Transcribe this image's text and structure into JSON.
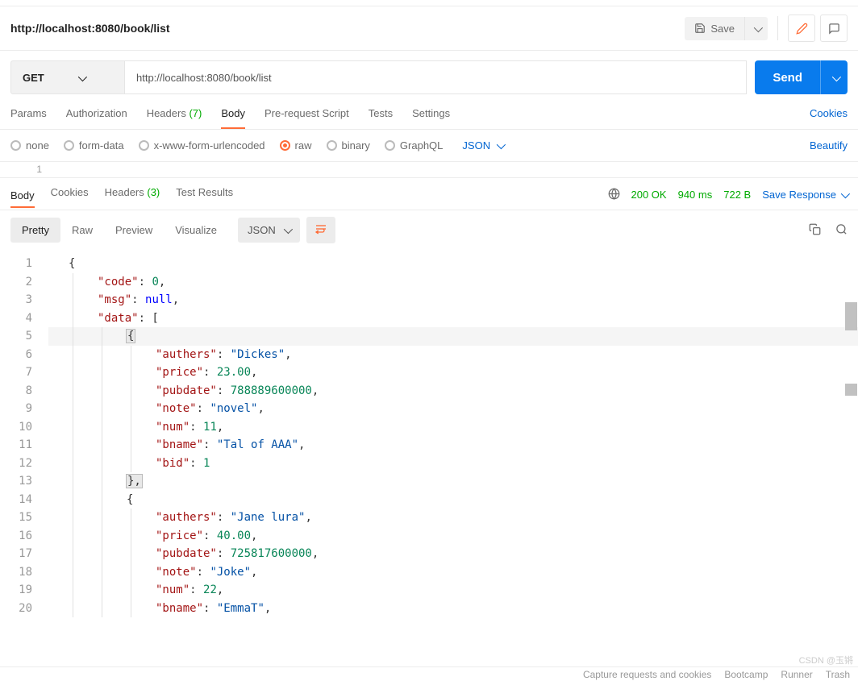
{
  "title": "http://localhost:8080/book/list",
  "save_label": "Save",
  "request": {
    "method": "GET",
    "url": "http://localhost:8080/book/list",
    "send_label": "Send"
  },
  "req_tabs": {
    "params": "Params",
    "auth": "Authorization",
    "headers": "Headers",
    "headers_count": "(7)",
    "body": "Body",
    "prs": "Pre-request Script",
    "tests": "Tests",
    "settings": "Settings",
    "cookies": "Cookies"
  },
  "body_types": {
    "none": "none",
    "formdata": "form-data",
    "urlenc": "x-www-form-urlencoded",
    "raw": "raw",
    "binary": "binary",
    "graphql": "GraphQL",
    "json": "JSON",
    "beautify": "Beautify"
  },
  "editor_line": "1",
  "resp_tabs": {
    "body": "Body",
    "cookies": "Cookies",
    "headers": "Headers",
    "headers_count": "(3)",
    "tests": "Test Results"
  },
  "resp_meta": {
    "status": "200 OK",
    "time": "940 ms",
    "size": "722 B",
    "save": "Save Response"
  },
  "view_tabs": {
    "pretty": "Pretty",
    "raw": "Raw",
    "preview": "Preview",
    "visualize": "Visualize",
    "json": "JSON"
  },
  "lines": [
    {
      "n": "1",
      "t": [
        {
          "c": "p",
          "v": "{"
        }
      ]
    },
    {
      "n": "2",
      "i": 1,
      "t": [
        {
          "c": "k",
          "v": "\"code\""
        },
        {
          "c": "p",
          "v": ": "
        },
        {
          "c": "n",
          "v": "0"
        },
        {
          "c": "p",
          "v": ","
        }
      ]
    },
    {
      "n": "3",
      "i": 1,
      "t": [
        {
          "c": "k",
          "v": "\"msg\""
        },
        {
          "c": "p",
          "v": ": "
        },
        {
          "c": "nul",
          "v": "null"
        },
        {
          "c": "p",
          "v": ","
        }
      ]
    },
    {
      "n": "4",
      "i": 1,
      "t": [
        {
          "c": "k",
          "v": "\"data\""
        },
        {
          "c": "p",
          "v": ": ["
        }
      ]
    },
    {
      "n": "5",
      "i": 2,
      "hl": true,
      "t": [
        {
          "c": "p",
          "v": "{"
        }
      ],
      "box": true
    },
    {
      "n": "6",
      "i": 3,
      "t": [
        {
          "c": "k",
          "v": "\"authers\""
        },
        {
          "c": "p",
          "v": ": "
        },
        {
          "c": "s",
          "v": "\"Dickes\""
        },
        {
          "c": "p",
          "v": ","
        }
      ]
    },
    {
      "n": "7",
      "i": 3,
      "t": [
        {
          "c": "k",
          "v": "\"price\""
        },
        {
          "c": "p",
          "v": ": "
        },
        {
          "c": "n",
          "v": "23.00"
        },
        {
          "c": "p",
          "v": ","
        }
      ]
    },
    {
      "n": "8",
      "i": 3,
      "t": [
        {
          "c": "k",
          "v": "\"pubdate\""
        },
        {
          "c": "p",
          "v": ": "
        },
        {
          "c": "n",
          "v": "788889600000"
        },
        {
          "c": "p",
          "v": ","
        }
      ]
    },
    {
      "n": "9",
      "i": 3,
      "t": [
        {
          "c": "k",
          "v": "\"note\""
        },
        {
          "c": "p",
          "v": ": "
        },
        {
          "c": "s",
          "v": "\"novel\""
        },
        {
          "c": "p",
          "v": ","
        }
      ]
    },
    {
      "n": "10",
      "i": 3,
      "t": [
        {
          "c": "k",
          "v": "\"num\""
        },
        {
          "c": "p",
          "v": ": "
        },
        {
          "c": "n",
          "v": "11"
        },
        {
          "c": "p",
          "v": ","
        }
      ]
    },
    {
      "n": "11",
      "i": 3,
      "t": [
        {
          "c": "k",
          "v": "\"bname\""
        },
        {
          "c": "p",
          "v": ": "
        },
        {
          "c": "s",
          "v": "\"Tal of AAA\""
        },
        {
          "c": "p",
          "v": ","
        }
      ]
    },
    {
      "n": "12",
      "i": 3,
      "t": [
        {
          "c": "k",
          "v": "\"bid\""
        },
        {
          "c": "p",
          "v": ": "
        },
        {
          "c": "n",
          "v": "1"
        }
      ]
    },
    {
      "n": "13",
      "i": 2,
      "t": [
        {
          "c": "p",
          "v": "},"
        }
      ],
      "box": true
    },
    {
      "n": "14",
      "i": 2,
      "t": [
        {
          "c": "p",
          "v": "{"
        }
      ]
    },
    {
      "n": "15",
      "i": 3,
      "t": [
        {
          "c": "k",
          "v": "\"authers\""
        },
        {
          "c": "p",
          "v": ": "
        },
        {
          "c": "s",
          "v": "\"Jane lura\""
        },
        {
          "c": "p",
          "v": ","
        }
      ]
    },
    {
      "n": "16",
      "i": 3,
      "t": [
        {
          "c": "k",
          "v": "\"price\""
        },
        {
          "c": "p",
          "v": ": "
        },
        {
          "c": "n",
          "v": "40.00"
        },
        {
          "c": "p",
          "v": ","
        }
      ]
    },
    {
      "n": "17",
      "i": 3,
      "t": [
        {
          "c": "k",
          "v": "\"pubdate\""
        },
        {
          "c": "p",
          "v": ": "
        },
        {
          "c": "n",
          "v": "725817600000"
        },
        {
          "c": "p",
          "v": ","
        }
      ]
    },
    {
      "n": "18",
      "i": 3,
      "t": [
        {
          "c": "k",
          "v": "\"note\""
        },
        {
          "c": "p",
          "v": ": "
        },
        {
          "c": "s",
          "v": "\"Joke\""
        },
        {
          "c": "p",
          "v": ","
        }
      ]
    },
    {
      "n": "19",
      "i": 3,
      "t": [
        {
          "c": "k",
          "v": "\"num\""
        },
        {
          "c": "p",
          "v": ": "
        },
        {
          "c": "n",
          "v": "22"
        },
        {
          "c": "p",
          "v": ","
        }
      ]
    },
    {
      "n": "20",
      "i": 3,
      "t": [
        {
          "c": "k",
          "v": "\"bname\""
        },
        {
          "c": "p",
          "v": ": "
        },
        {
          "c": "s",
          "v": "\"EmmaT\""
        },
        {
          "c": "p",
          "v": ","
        }
      ]
    }
  ],
  "watermark": "CSDN @玉锵",
  "footer": {
    "capture": "Capture requests and cookies",
    "bootcamp": "Bootcamp",
    "runner": "Runner",
    "trash": "Trash"
  }
}
